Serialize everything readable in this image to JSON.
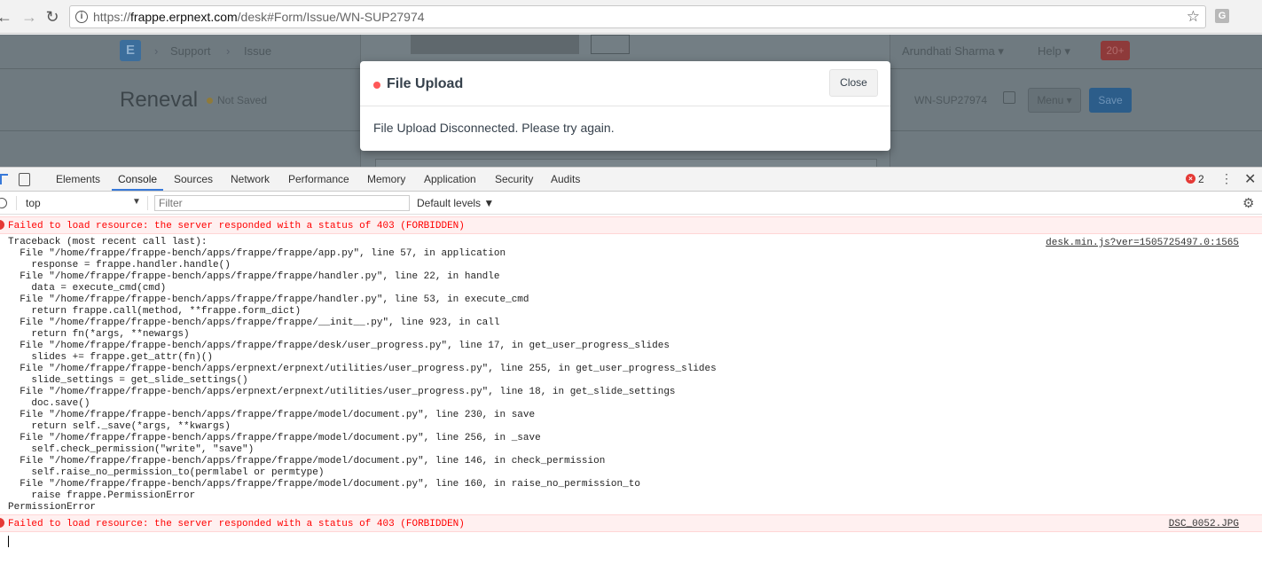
{
  "browser": {
    "url_prefix": "https://",
    "url_host": "frappe.erpnext.com",
    "url_path": "/desk#Form/Issue/WN-SUP27974",
    "extension_letter": "G"
  },
  "app": {
    "logo_letter": "E",
    "breadcrumbs": [
      "Support",
      "Issue"
    ],
    "user_menu": "Arundhati Sharma ▾",
    "help_menu": "Help ▾",
    "notification_count": "20+",
    "page_title": "Reneval",
    "status": "Not Saved",
    "doc_name": "WN-SUP27974",
    "menu_label": "Menu ▾",
    "save_label": "Save"
  },
  "modal": {
    "title": "File Upload",
    "close_label": "Close",
    "message": "File Upload Disconnected. Please try again.",
    "indicator_color": "#ff5858"
  },
  "devtools": {
    "tabs": [
      "Elements",
      "Console",
      "Sources",
      "Network",
      "Performance",
      "Memory",
      "Application",
      "Security",
      "Audits"
    ],
    "active_tab": "Console",
    "error_count": "2",
    "context": "top",
    "filter_placeholder": "Filter",
    "levels_label": "Default levels ▼"
  },
  "console": {
    "error_1": "Failed to load resource: the server responded with a status of 403 (FORBIDDEN)",
    "traceback_source": "desk.min.js?ver=1505725497.0:1565",
    "traceback": [
      "Traceback (most recent call last):",
      "  File \"/home/frappe/frappe-bench/apps/frappe/frappe/app.py\", line 57, in application",
      "    response = frappe.handler.handle()",
      "  File \"/home/frappe/frappe-bench/apps/frappe/frappe/handler.py\", line 22, in handle",
      "    data = execute_cmd(cmd)",
      "  File \"/home/frappe/frappe-bench/apps/frappe/frappe/handler.py\", line 53, in execute_cmd",
      "    return frappe.call(method, **frappe.form_dict)",
      "  File \"/home/frappe/frappe-bench/apps/frappe/frappe/__init__.py\", line 923, in call",
      "    return fn(*args, **newargs)",
      "  File \"/home/frappe/frappe-bench/apps/frappe/frappe/desk/user_progress.py\", line 17, in get_user_progress_slides",
      "    slides += frappe.get_attr(fn)()",
      "  File \"/home/frappe/frappe-bench/apps/erpnext/erpnext/utilities/user_progress.py\", line 255, in get_user_progress_slides",
      "    slide_settings = get_slide_settings()",
      "  File \"/home/frappe/frappe-bench/apps/erpnext/erpnext/utilities/user_progress.py\", line 18, in get_slide_settings",
      "    doc.save()",
      "  File \"/home/frappe/frappe-bench/apps/frappe/frappe/model/document.py\", line 230, in save",
      "    return self._save(*args, **kwargs)",
      "  File \"/home/frappe/frappe-bench/apps/frappe/frappe/model/document.py\", line 256, in _save",
      "    self.check_permission(\"write\", \"save\")",
      "  File \"/home/frappe/frappe-bench/apps/frappe/frappe/model/document.py\", line 146, in check_permission",
      "    self.raise_no_permission_to(permlabel or permtype)",
      "  File \"/home/frappe/frappe-bench/apps/frappe/frappe/model/document.py\", line 160, in raise_no_permission_to",
      "    raise frappe.PermissionError",
      "PermissionError"
    ],
    "error_2": "Failed to load resource: the server responded with a status of 403 (FORBIDDEN)",
    "error_2_source": "DSC_0052.JPG"
  }
}
